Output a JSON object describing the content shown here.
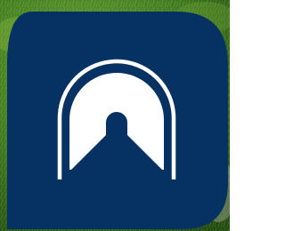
{
  "image": {
    "subject": "tunnel-icon",
    "colors": {
      "tile": "#063263",
      "symbol": "#ffffff",
      "grass_light": "#5f9a2c",
      "grass_mid": "#3f7a1e",
      "grass_dark": "#234d10",
      "ground": "#b9bcad"
    }
  }
}
